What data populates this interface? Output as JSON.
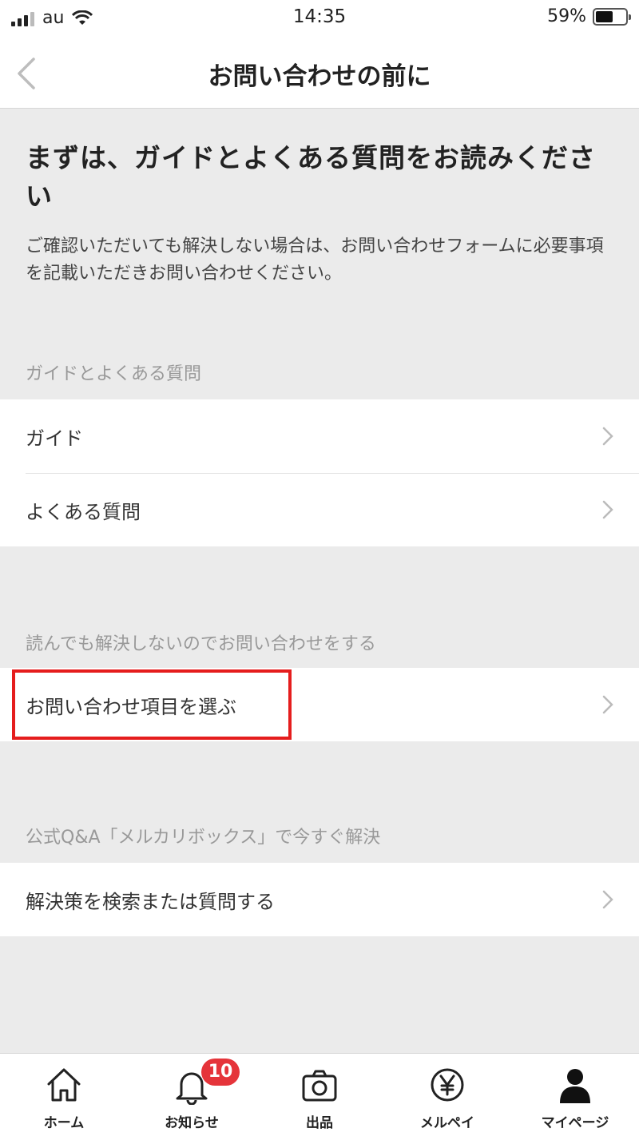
{
  "status_bar": {
    "carrier": "au",
    "time": "14:35",
    "battery_percent": "59%",
    "battery_level": 0.59
  },
  "nav": {
    "title": "お問い合わせの前に",
    "back_icon": "chevron-left-icon"
  },
  "intro": {
    "heading": "まずは、ガイドとよくある質問をお読みください",
    "description": "ご確認いただいても解決しない場合は、お問い合わせフォームに必要事項を記載いただきお問い合わせください。"
  },
  "sections": [
    {
      "header": "ガイドとよくある質問",
      "items": [
        {
          "label": "ガイド"
        },
        {
          "label": "よくある質問"
        }
      ]
    },
    {
      "header": "読んでも解決しないのでお問い合わせをする",
      "items": [
        {
          "label": "お問い合わせ項目を選ぶ"
        }
      ]
    },
    {
      "header": "公式Q&A「メルカリボックス」で今すぐ解決",
      "items": [
        {
          "label": "解決策を検索または質問する"
        }
      ]
    }
  ],
  "tabbar": {
    "tabs": [
      {
        "label": "ホーム",
        "icon": "home-icon"
      },
      {
        "label": "お知らせ",
        "icon": "bell-icon",
        "badge": "10"
      },
      {
        "label": "出品",
        "icon": "camera-icon"
      },
      {
        "label": "メルペイ",
        "icon": "yen-coin-icon"
      },
      {
        "label": "マイページ",
        "icon": "person-icon"
      }
    ]
  },
  "colors": {
    "background": "#ebebeb",
    "highlight": "#e51d1d",
    "badge": "#e5343a"
  }
}
